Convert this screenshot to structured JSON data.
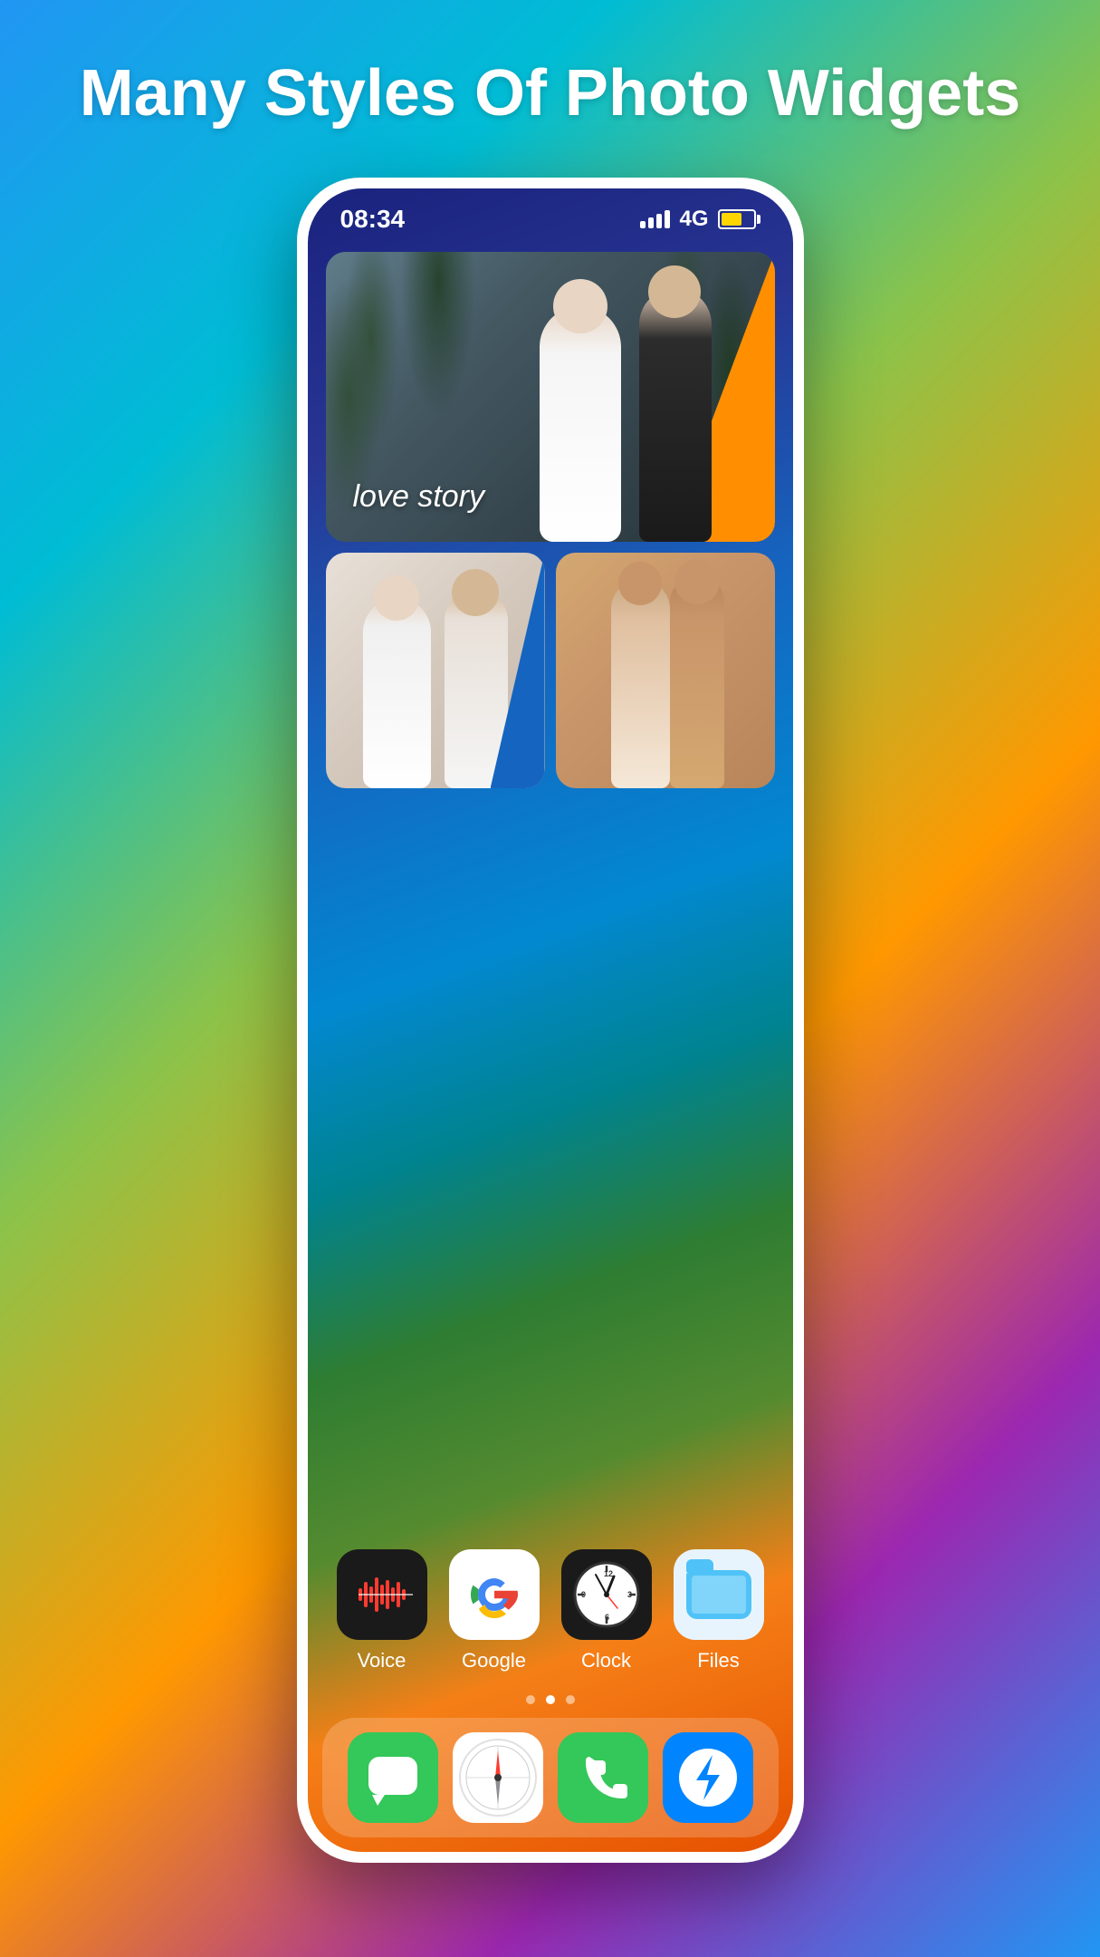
{
  "header": {
    "title": "Many Styles Of Photo Widgets"
  },
  "statusBar": {
    "time": "08:34",
    "network": "4G"
  },
  "photoWidget": {
    "loveStoryLabel": "love story"
  },
  "appIcons": [
    {
      "id": "voice",
      "label": "Voice"
    },
    {
      "id": "google",
      "label": "Google"
    },
    {
      "id": "clock",
      "label": "Clock"
    },
    {
      "id": "files",
      "label": "Files"
    }
  ],
  "dockApps": [
    {
      "id": "messages",
      "label": "Messages"
    },
    {
      "id": "safari",
      "label": "Safari"
    },
    {
      "id": "phone",
      "label": "Phone"
    },
    {
      "id": "messenger",
      "label": "Messenger"
    }
  ],
  "pageDots": [
    {
      "active": true
    },
    {
      "active": false
    },
    {
      "active": false
    }
  ]
}
